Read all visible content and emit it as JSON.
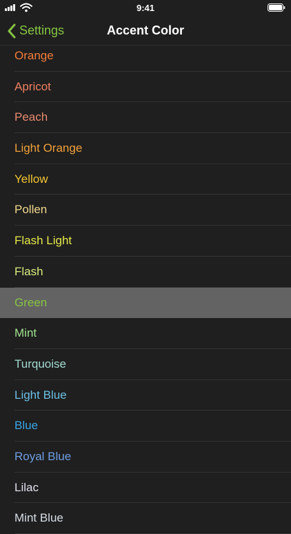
{
  "status_bar": {
    "time": "9:41"
  },
  "nav": {
    "back_label": "Settings",
    "title": "Accent Color"
  },
  "colors": {
    "accent": "#86c442",
    "background": "#1f1f1f",
    "selected_row": "#636363"
  },
  "accent_options": [
    {
      "label": "Orange",
      "color": "#f47d3a"
    },
    {
      "label": "Apricot",
      "color": "#ee8060"
    },
    {
      "label": "Peach",
      "color": "#e98a70"
    },
    {
      "label": "Light Orange",
      "color": "#f2a03a"
    },
    {
      "label": "Yellow",
      "color": "#f2c533"
    },
    {
      "label": "Pollen",
      "color": "#f1d88c"
    },
    {
      "label": "Flash Light",
      "color": "#e6ea4a"
    },
    {
      "label": "Flash",
      "color": "#d9ee7d"
    },
    {
      "label": "Green",
      "color": "#86c442",
      "selected": true
    },
    {
      "label": "Mint",
      "color": "#9fe08e"
    },
    {
      "label": "Turquoise",
      "color": "#a3d9d1"
    },
    {
      "label": "Light Blue",
      "color": "#6cc0e6"
    },
    {
      "label": "Blue",
      "color": "#3aa5e6"
    },
    {
      "label": "Royal Blue",
      "color": "#6e9ee3"
    },
    {
      "label": "Lilac",
      "color": "#e4e0f0"
    },
    {
      "label": "Mint Blue",
      "color": "#d6dde6"
    }
  ]
}
